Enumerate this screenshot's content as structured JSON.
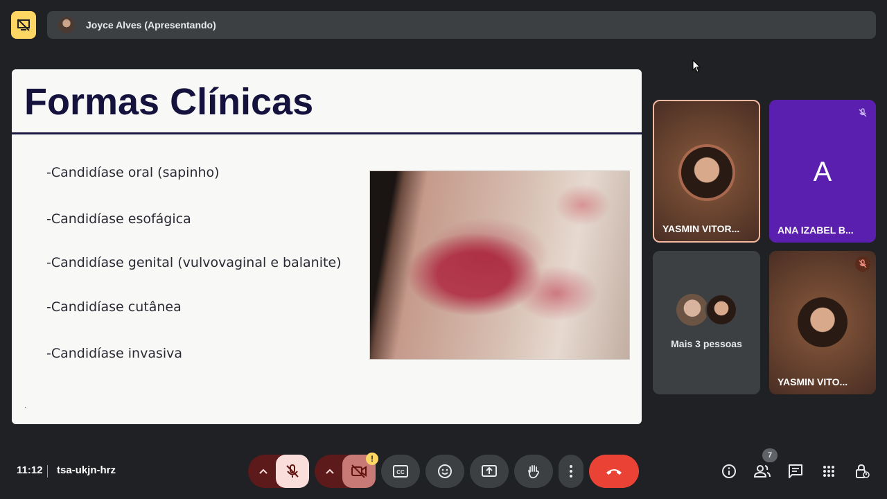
{
  "topbar": {
    "present_icon": "presentation-off-icon",
    "presenter_label": "Joyce Alves (Apresentando)"
  },
  "slide": {
    "title": "Formas Clínicas",
    "bullets": [
      "-Candidíase oral (sapinho)",
      "-Candidíase esofágica",
      "-Candidíase genital (vulvovaginal e balanite)",
      "-Candidíase cutânea",
      "-Candidíase invasiva"
    ],
    "footnote": "."
  },
  "participants": [
    {
      "name": "YASMIN VITOR...",
      "active_speaker": true
    },
    {
      "name": "ANA IZABEL B...",
      "initial": "A",
      "muted": true
    },
    {
      "label": "Mais 3 pessoas"
    },
    {
      "name": "YASMIN VITO...",
      "muted": true
    }
  ],
  "bottom": {
    "time": "11:12",
    "meeting_code": "tsa-ukjn-hrz",
    "people_count": "7",
    "camera_warning": "!"
  },
  "colors": {
    "background": "#202124",
    "end_call": "#ea4335",
    "mic_off_bg": "#f9dedc",
    "accent_yellow": "#fdd663",
    "purple_tile": "#5b1fb0"
  }
}
